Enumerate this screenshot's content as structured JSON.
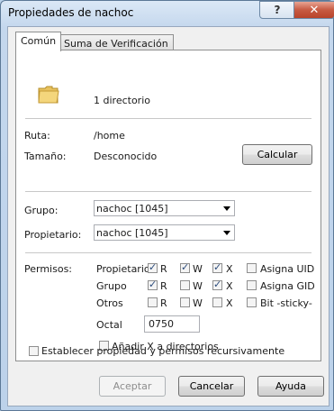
{
  "window": {
    "title": "Propiedades de nachoc",
    "help_glyph": "?",
    "close_glyph": "✕"
  },
  "tabs": [
    {
      "label": "Común",
      "active": true
    },
    {
      "label": "Suma de Verificación",
      "active": false
    }
  ],
  "summary": {
    "icon": "folder-icon",
    "text": "1 directorio"
  },
  "info": {
    "ruta_label": "Ruta:",
    "ruta_value": "/home",
    "tamano_label": "Tamaño:",
    "tamano_value": "Desconocido",
    "calcular_label": "Calcular"
  },
  "ownership": {
    "grupo_label": "Grupo:",
    "grupo_value": "nachoc [1045]",
    "propietario_label": "Propietario:",
    "propietario_value": "nachoc [1045]"
  },
  "permissions": {
    "label": "Permisos:",
    "rows": [
      {
        "name": "Propietario",
        "r": true,
        "w": true,
        "x": true,
        "extra_label": "Asigna UID",
        "extra": false
      },
      {
        "name": "Grupo",
        "r": true,
        "w": false,
        "x": true,
        "extra_label": "Asigna GID",
        "extra": false
      },
      {
        "name": "Otros",
        "r": false,
        "w": false,
        "x": false,
        "extra_label": "Bit -sticky-",
        "extra": false
      }
    ],
    "r_label": "R",
    "w_label": "W",
    "x_label": "X",
    "octal_label": "Octal",
    "octal_value": "0750",
    "add_x_label": "Añadir X a directorios",
    "add_x": false
  },
  "recursive": {
    "label": "Establecer propiedad y permisos recursivamente",
    "checked": false
  },
  "buttons": {
    "aceptar": "Aceptar",
    "cancelar": "Cancelar",
    "ayuda": "Ayuda"
  }
}
